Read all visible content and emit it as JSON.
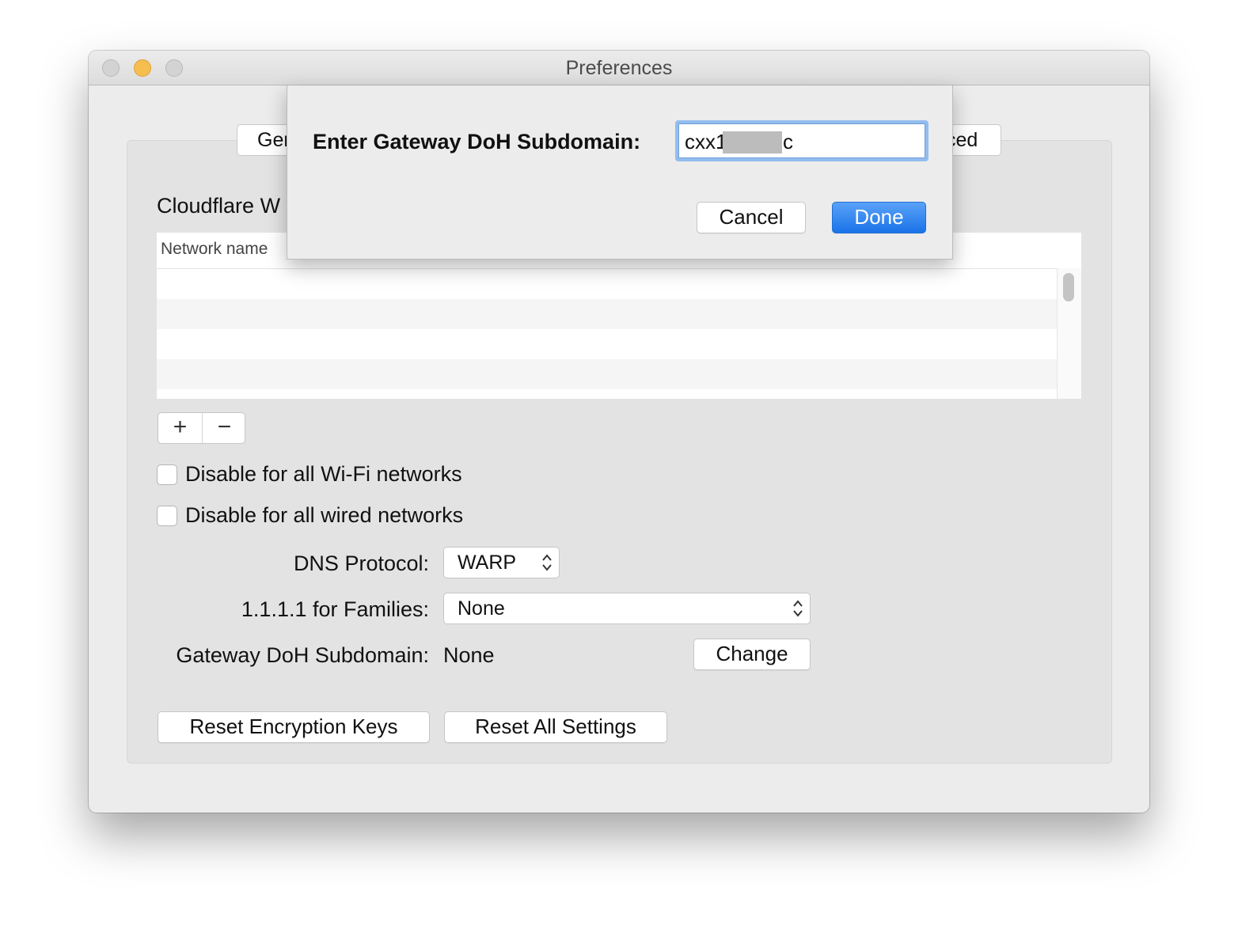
{
  "window": {
    "title": "Preferences"
  },
  "tabs": {
    "left_partial": "Ger",
    "right_partial": "ced"
  },
  "section": {
    "title": "Cloudflare W"
  },
  "table": {
    "column_header": "Network name",
    "rows": [
      "",
      "",
      "",
      ""
    ]
  },
  "list_buttons": {
    "add": "+",
    "remove": "−"
  },
  "options": {
    "disable_wifi": "Disable for all Wi-Fi networks",
    "disable_wired": "Disable for all wired networks"
  },
  "form": {
    "dns_protocol_label": "DNS Protocol:",
    "dns_protocol_value": "WARP",
    "families_label": "1.1.1.1 for Families:",
    "families_value": "None",
    "doh_label": "Gateway DoH Subdomain:",
    "doh_value": "None",
    "change_button": "Change"
  },
  "bottom_buttons": {
    "reset_keys": "Reset Encryption Keys",
    "reset_all": "Reset All Settings"
  },
  "sheet": {
    "label": "Enter Gateway DoH Subdomain:",
    "input_value_visible_start": "cxx1",
    "input_value_visible_end": "c",
    "cancel": "Cancel",
    "done": "Done"
  },
  "colors": {
    "accent": "#1a73e8",
    "focus_ring": "#93bdf0",
    "window_bg": "#ececec"
  }
}
